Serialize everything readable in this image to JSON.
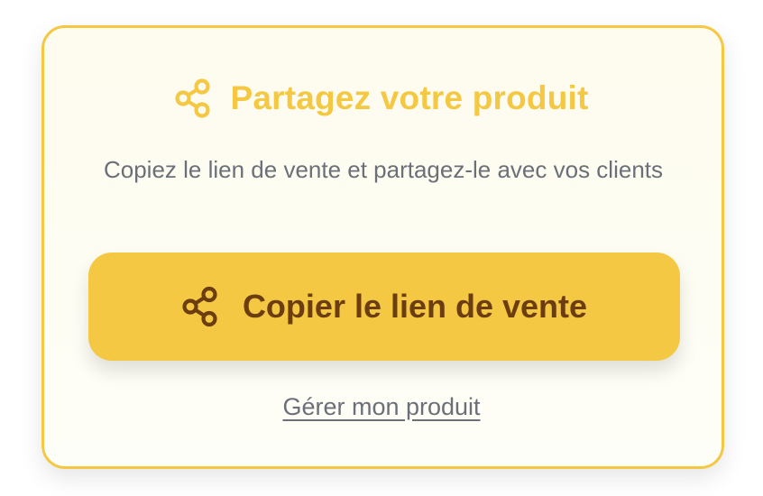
{
  "card": {
    "title": "Partagez votre produit",
    "title_icon": "share-icon",
    "description": "Copiez le lien de vente et partagez-le avec vos clients",
    "copy_button": {
      "label": "Copier le lien de vente",
      "icon": "share-icon"
    },
    "manage_link": "Gérer mon produit"
  },
  "colors": {
    "accent": "#f4c843",
    "button_text": "#6b3d10",
    "muted_text": "#6b6f78",
    "card_background": "#fefcee"
  }
}
